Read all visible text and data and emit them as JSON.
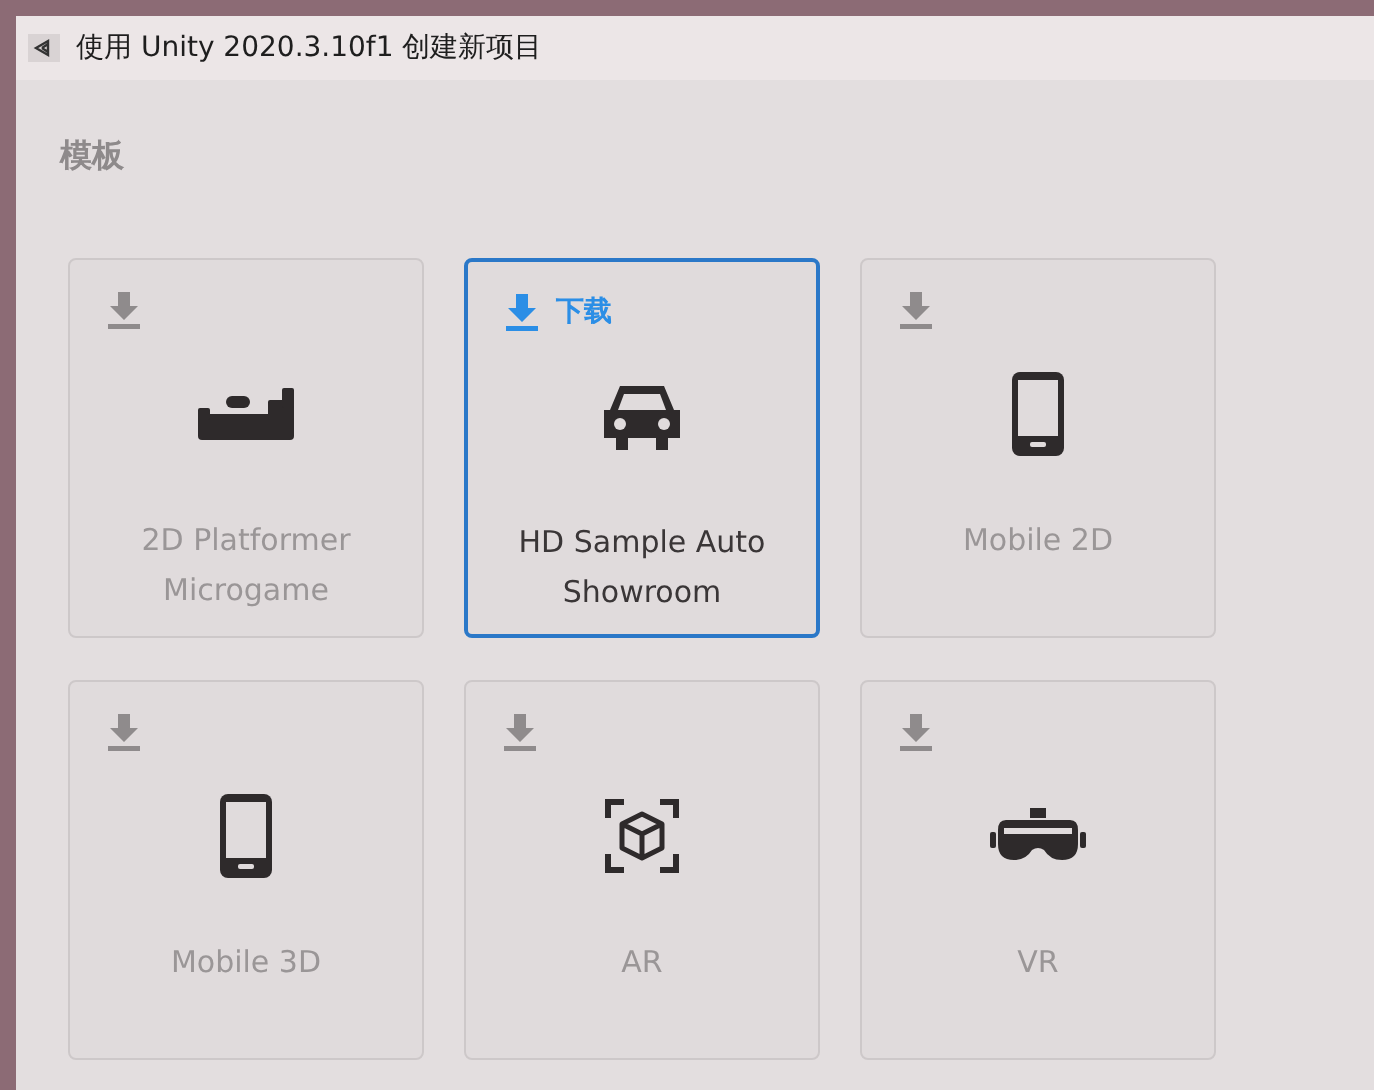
{
  "window": {
    "title": "使用 Unity 2020.3.10f1 创建新项目"
  },
  "section_title": "模板",
  "templates": [
    {
      "name": "2D Platformer Microgame",
      "kind": "platformer",
      "selected": false
    },
    {
      "name": "HD Sample Auto Showroom",
      "kind": "car",
      "selected": true,
      "download_label": "下载"
    },
    {
      "name": "Mobile 2D",
      "kind": "phone",
      "selected": false
    },
    {
      "name": "Mobile 3D",
      "kind": "phone",
      "selected": false
    },
    {
      "name": "AR",
      "kind": "ar",
      "selected": false
    },
    {
      "name": "VR",
      "kind": "vr",
      "selected": false
    }
  ]
}
